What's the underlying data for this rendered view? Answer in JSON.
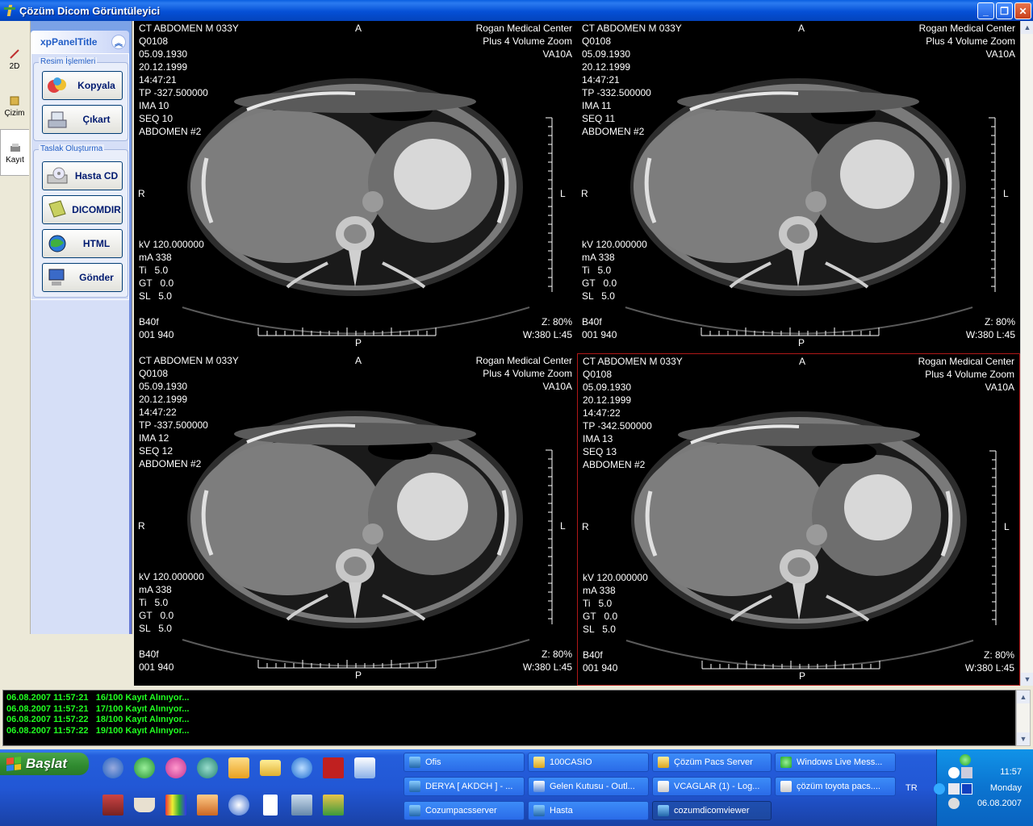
{
  "window": {
    "title": "Çözüm Dicom Görüntüleyici"
  },
  "tabs": [
    {
      "label": "2D"
    },
    {
      "label": "Çizim"
    },
    {
      "label": "Kayıt"
    }
  ],
  "panel": {
    "title": "xpPanelTitle",
    "groups": [
      {
        "label": "Resim İşlemleri",
        "buttons": [
          {
            "label": "Kopyala",
            "icon": "copy-icon"
          },
          {
            "label": "Çıkart",
            "icon": "export-icon"
          }
        ]
      },
      {
        "label": "Taslak Oluşturma",
        "buttons": [
          {
            "label": "Hasta CD",
            "icon": "cd-icon"
          },
          {
            "label": "DICOMDIR",
            "icon": "dicomdir-icon"
          },
          {
            "label": "HTML",
            "icon": "html-globe-icon"
          },
          {
            "label": "Gönder",
            "icon": "send-computer-icon"
          }
        ]
      }
    ]
  },
  "viewer": {
    "tiles": [
      {
        "study": "CT ABDOMEN M 033Y",
        "id": "Q0108",
        "birth": "05.09.1930",
        "date": "20.12.1999",
        "time": "14:47:21",
        "tp": "TP -327.500000",
        "ima": "IMA 10",
        "seq": "SEQ 10",
        "series": "ABDOMEN #2",
        "institution": "Rogan Medical Center",
        "model": "Plus 4 Volume Zoom",
        "version": "VA10A",
        "kv": "kV 120.000000",
        "ma": "mA 338",
        "ti": "Ti   5.0",
        "gt": "GT   0.0",
        "sl": "SL   5.0",
        "kernel": "B40f",
        "code": "001 940",
        "zoom": "Z: 80%",
        "window": "W:380 L:45",
        "orient": {
          "top": "A",
          "bottom": "P",
          "left": "R",
          "right": "L"
        },
        "selected": false
      },
      {
        "study": "CT ABDOMEN M 033Y",
        "id": "Q0108",
        "birth": "05.09.1930",
        "date": "20.12.1999",
        "time": "14:47:21",
        "tp": "TP -332.500000",
        "ima": "IMA 11",
        "seq": "SEQ 11",
        "series": "ABDOMEN #2",
        "institution": "Rogan Medical Center",
        "model": "Plus 4 Volume Zoom",
        "version": "VA10A",
        "kv": "kV 120.000000",
        "ma": "mA 338",
        "ti": "Ti   5.0",
        "gt": "GT   0.0",
        "sl": "SL   5.0",
        "kernel": "B40f",
        "code": "001 940",
        "zoom": "Z: 80%",
        "window": "W:380 L:45",
        "orient": {
          "top": "A",
          "bottom": "P",
          "left": "R",
          "right": "L"
        },
        "selected": false
      },
      {
        "study": "CT ABDOMEN M 033Y",
        "id": "Q0108",
        "birth": "05.09.1930",
        "date": "20.12.1999",
        "time": "14:47:22",
        "tp": "TP -337.500000",
        "ima": "IMA 12",
        "seq": "SEQ 12",
        "series": "ABDOMEN #2",
        "institution": "Rogan Medical Center",
        "model": "Plus 4 Volume Zoom",
        "version": "VA10A",
        "kv": "kV 120.000000",
        "ma": "mA 338",
        "ti": "Ti   5.0",
        "gt": "GT   0.0",
        "sl": "SL   5.0",
        "kernel": "B40f",
        "code": "001 940",
        "zoom": "Z: 80%",
        "window": "W:380 L:45",
        "orient": {
          "top": "A",
          "bottom": "P",
          "left": "R",
          "right": "L"
        },
        "selected": false
      },
      {
        "study": "CT ABDOMEN M 033Y",
        "id": "Q0108",
        "birth": "05.09.1930",
        "date": "20.12.1999",
        "time": "14:47:22",
        "tp": "TP -342.500000",
        "ima": "IMA 13",
        "seq": "SEQ 13",
        "series": "ABDOMEN #2",
        "institution": "Rogan Medical Center",
        "model": "Plus 4 Volume Zoom",
        "version": "VA10A",
        "kv": "kV 120.000000",
        "ma": "mA 338",
        "ti": "Ti   5.0",
        "gt": "GT   0.0",
        "sl": "SL   5.0",
        "kernel": "B40f",
        "code": "001 940",
        "zoom": "Z: 80%",
        "window": "W:380 L:45",
        "orient": {
          "top": "A",
          "bottom": "P",
          "left": "R",
          "right": "L"
        },
        "selected": true
      }
    ],
    "selected_border_color": "#b01818"
  },
  "log": [
    "06.08.2007 11:57:21   16/100 Kayıt Alınıyor...",
    "06.08.2007 11:57:21   17/100 Kayıt Alınıyor...",
    "06.08.2007 11:57:22   18/100 Kayıt Alınıyor...",
    "06.08.2007 11:57:22   19/100 Kayıt Alınıyor..."
  ],
  "taskbar": {
    "start_label": "Başlat",
    "tasks": [
      {
        "label": "Ofis",
        "icon": "app-icon",
        "active": false
      },
      {
        "label": "100CASIO",
        "icon": "folder-icon",
        "active": false
      },
      {
        "label": "Çözüm Pacs Server",
        "icon": "folder-icon",
        "active": false
      },
      {
        "label": "Windows Live Mess...",
        "icon": "messenger-icon",
        "active": false
      },
      {
        "label": "DERYA [ AKDCH ] - ...",
        "icon": "app-icon",
        "active": false
      },
      {
        "label": "Gelen Kutusu - Outl...",
        "icon": "outlook-icon",
        "active": false
      },
      {
        "label": "VCAGLAR (1) - Log...",
        "icon": "document-icon",
        "active": false
      },
      {
        "label": "çözüm toyota pacs....",
        "icon": "document-icon",
        "active": false
      },
      {
        "label": "Cozumpacsserver",
        "icon": "app-icon",
        "active": false
      },
      {
        "label": "Hasta",
        "icon": "app-icon",
        "active": false
      },
      {
        "label": "cozumdicomviewer",
        "icon": "app-icon",
        "active": true
      }
    ],
    "language": "TR",
    "clock": {
      "time": "11:57",
      "day": "Monday",
      "date": "06.08.2007"
    }
  },
  "colors": {
    "log_text": "#20ff20",
    "taskbar": "#245EDB",
    "panel_bg": "#D6DFF7"
  }
}
